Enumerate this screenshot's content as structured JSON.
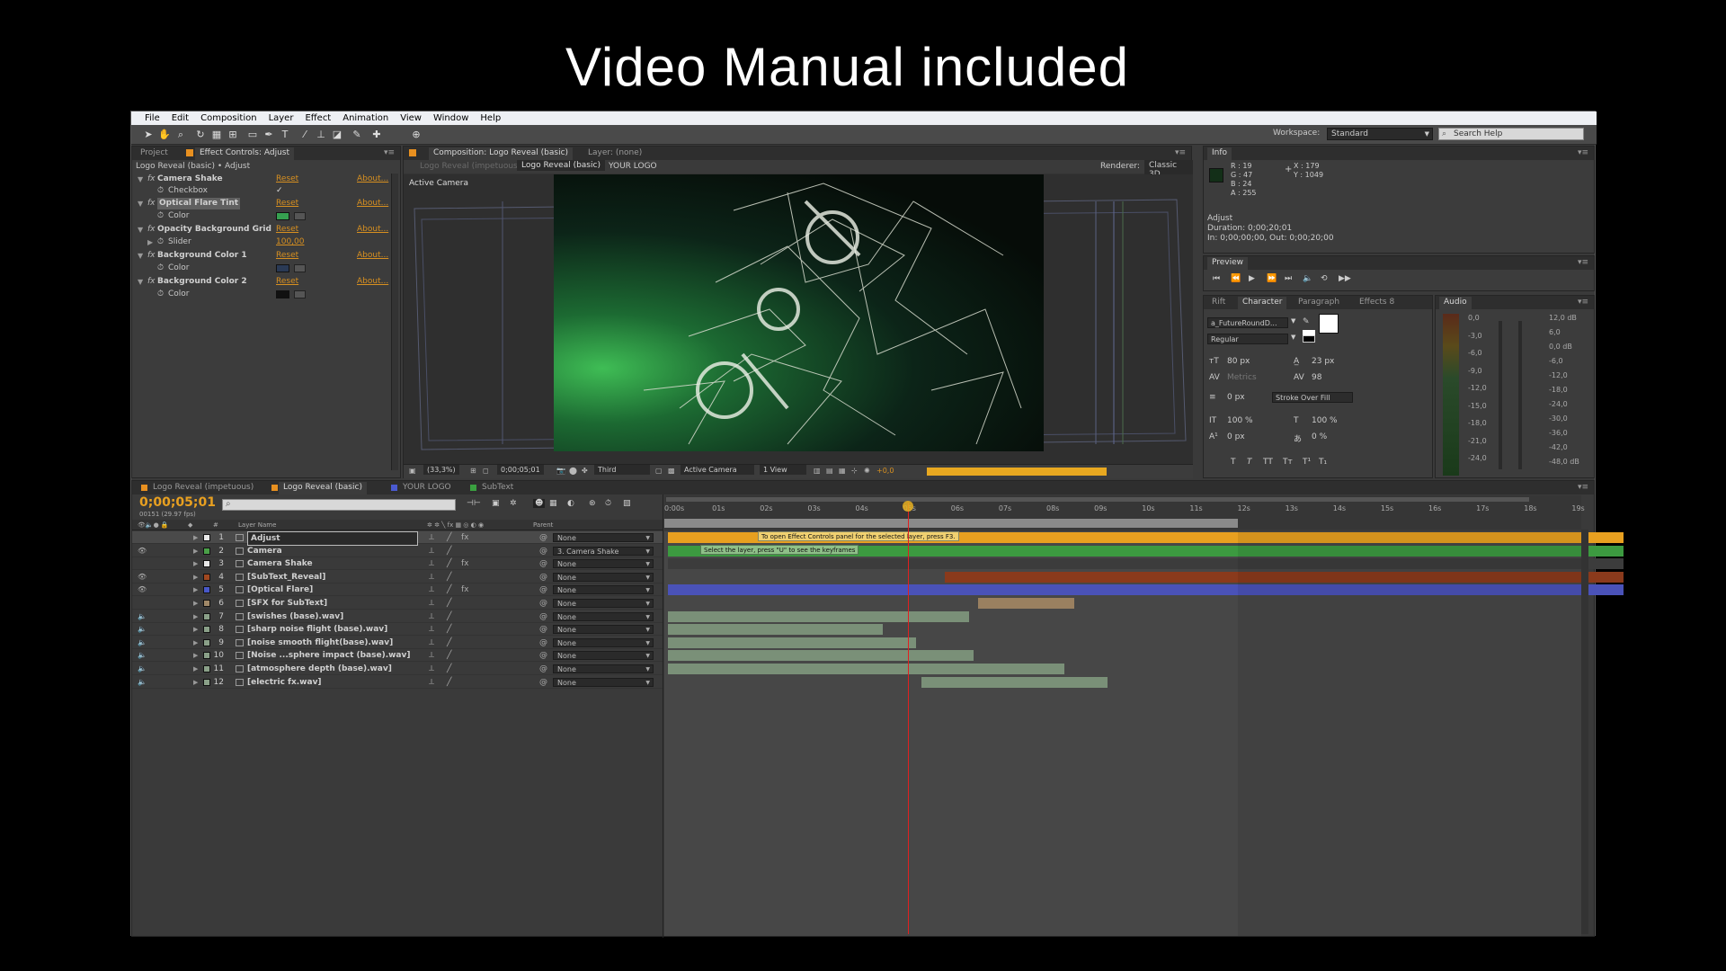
{
  "title": "Video Manual included",
  "menu": [
    "File",
    "Edit",
    "Composition",
    "Layer",
    "Effect",
    "Animation",
    "View",
    "Window",
    "Help"
  ],
  "workspace": {
    "label": "Workspace:",
    "value": "Standard",
    "search": "Search Help"
  },
  "left_panel": {
    "tabs": [
      "Project",
      "Effect Controls: Adjust"
    ],
    "breadcrumb": "Logo Reveal (basic) • Adjust",
    "effects": [
      {
        "name": "Camera Shake",
        "reset": "Reset",
        "about": "About..."
      },
      {
        "name": "Optical Flare Tint",
        "reset": "Reset",
        "about": "About..."
      },
      {
        "name": "Opacity Background Grid",
        "reset": "Reset",
        "about": "About..."
      },
      {
        "name": "Background Color 1",
        "reset": "Reset",
        "about": "About..."
      },
      {
        "name": "Background Color 2",
        "reset": "Reset",
        "about": "About..."
      }
    ],
    "props": {
      "checkbox": "Checkbox",
      "color": "Color",
      "slider": "Slider",
      "slider_value": "100,00",
      "check": "✓"
    },
    "colors": {
      "tint": "#36a050",
      "bg1": "#2a3a55",
      "bg2": "#111111"
    }
  },
  "comp": {
    "tabs": [
      "Composition: Logo Reveal (basic)",
      "Layer: (none)"
    ],
    "subtabs": [
      "Logo Reveal (impetuous)",
      "Logo Reveal (basic)",
      "YOUR LOGO"
    ],
    "renderer_label": "Renderer:",
    "renderer": "Classic 3D",
    "camera_label": "Active Camera",
    "footer": {
      "zoom": "(33,3%)",
      "time": "0;00;05;01",
      "res": "Third",
      "camera": "Active Camera",
      "views": "1 View",
      "exposure": "+0,0"
    }
  },
  "info": {
    "tab": "Info",
    "r": "R : 19",
    "g": "G : 47",
    "b": "B : 24",
    "a": "A : 255",
    "x": "X : 179",
    "y": "Y : 1049",
    "layer": "Adjust",
    "duration": "Duration: 0;00;20;01",
    "inout": "In: 0;00;00;00, Out: 0;00;20;00",
    "swatch": "#132f18"
  },
  "preview": {
    "tab": "Preview"
  },
  "character": {
    "tabs": [
      "Rift",
      "Character",
      "Paragraph",
      "Effects 8"
    ],
    "font": "a_FutureRoundD...",
    "style": "Regular",
    "size": "80 px",
    "leading": "23 px",
    "kerning": "Metrics",
    "tracking": "98",
    "stroke": "0 px",
    "stroke_mode": "Stroke Over Fill",
    "vscale": "100 %",
    "hscale": "100 %",
    "baseline": "0 px",
    "tsume": "0 %",
    "styles": [
      "T",
      "T",
      "TT",
      "Tт",
      "T¹",
      "T₁"
    ]
  },
  "audio": {
    "tab": "Audio",
    "left_levels": [
      "0,0",
      "-3,0",
      "-6,0",
      "-9,0",
      "-12,0",
      "-15,0",
      "-18,0",
      "-21,0",
      "-24,0"
    ],
    "right_levels": [
      "12,0 dB",
      "6,0",
      "0,0 dB",
      "-6,0",
      "-12,0",
      "-18,0",
      "-24,0",
      "-30,0",
      "-36,0",
      "-42,0",
      "-48,0 dB"
    ]
  },
  "timeline": {
    "tabs": [
      "Logo Reveal (impetuous)",
      "Logo Reveal (basic)",
      "YOUR LOGO",
      "SubText"
    ],
    "timecode": "0;00;05;01",
    "fps": "00151 (29.97 fps)",
    "search_placeholder": "",
    "col_layer": "Layer Name",
    "col_parent": "Parent",
    "col_num": "#",
    "ticks": [
      "0:00s",
      "01s",
      "02s",
      "03s",
      "04s",
      "05s",
      "06s",
      "07s",
      "08s",
      "09s",
      "10s",
      "11s",
      "12s",
      "13s",
      "14s",
      "15s",
      "16s",
      "17s",
      "18s",
      "19s"
    ],
    "tooltip1": "To open Effect Controls panel for the selected layer, press F3.",
    "tooltip2": "Select the layer, press \"U\" to see the keyframes",
    "layers": [
      {
        "num": "1",
        "name": "Adjust",
        "color": "#e8e8e8",
        "parent": "None",
        "fx": true
      },
      {
        "num": "2",
        "name": "Camera",
        "color": "#4aa048",
        "parent": "3. Camera Shake",
        "fx": false
      },
      {
        "num": "3",
        "name": "Camera Shake",
        "color": "#e8e8e8",
        "parent": "None",
        "fx": true
      },
      {
        "num": "4",
        "name": "[SubText_Reveal]",
        "color": "#a04820",
        "parent": "None",
        "fx": false
      },
      {
        "num": "5",
        "name": "[Optical Flare]",
        "color": "#4858c8",
        "parent": "None",
        "fx": true
      },
      {
        "num": "6",
        "name": "[SFX for SubText]",
        "color": "#a08868",
        "parent": "None",
        "fx": false
      },
      {
        "num": "7",
        "name": "[swishes (base).wav]",
        "color": "#8aa088",
        "parent": "None",
        "fx": false
      },
      {
        "num": "8",
        "name": "[sharp noise flight (base).wav]",
        "color": "#8aa088",
        "parent": "None",
        "fx": false
      },
      {
        "num": "9",
        "name": "[noise smooth flight(base).wav]",
        "color": "#8aa088",
        "parent": "None",
        "fx": false
      },
      {
        "num": "10",
        "name": "[Noise ...sphere impact (base).wav]",
        "color": "#8aa088",
        "parent": "None",
        "fx": false
      },
      {
        "num": "11",
        "name": "[atmosphere depth (base).wav]",
        "color": "#8aa088",
        "parent": "None",
        "fx": false
      },
      {
        "num": "12",
        "name": "[electric fx.wav]",
        "color": "#8aa088",
        "parent": "None",
        "fx": false
      }
    ],
    "bars": [
      {
        "start": 0,
        "end": 20,
        "color": "#e8a020"
      },
      {
        "start": 0,
        "end": 20,
        "color": "#3c9a40"
      },
      {
        "start": 0,
        "end": 20,
        "color": "#3c3c3c"
      },
      {
        "start": 5.8,
        "end": 20,
        "color": "#8a3a1c"
      },
      {
        "start": 0,
        "end": 20,
        "color": "#4a52b8"
      },
      {
        "start": 6.5,
        "end": 8.5,
        "color": "#9a8060"
      },
      {
        "start": 0,
        "end": 6.3,
        "color": "#7a9078"
      },
      {
        "start": 0,
        "end": 4.5,
        "color": "#7a9078"
      },
      {
        "start": 0,
        "end": 5.2,
        "color": "#7a9078"
      },
      {
        "start": 0,
        "end": 6.4,
        "color": "#7a9078"
      },
      {
        "start": 0,
        "end": 8.3,
        "color": "#7a9078"
      },
      {
        "start": 5.3,
        "end": 9.2,
        "color": "#7a9078"
      }
    ],
    "current_time_sec": 5.03,
    "work_area_end_sec": 12
  }
}
